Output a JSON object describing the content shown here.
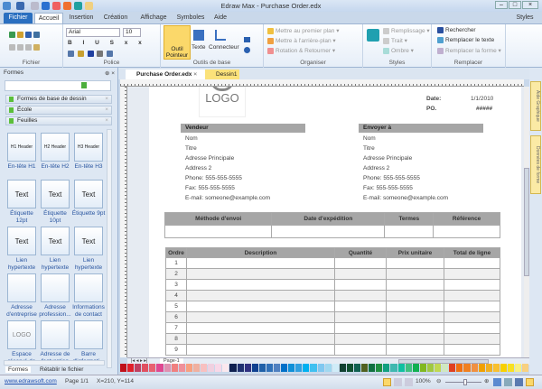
{
  "window": {
    "title": "Edraw Max - Purchase Order.edx",
    "styles_label": "Styles"
  },
  "tabs": [
    "Fichier",
    "Accueil",
    "Insertion",
    "Création",
    "Affichage",
    "Symboles",
    "Aide"
  ],
  "ribbon": {
    "groups": [
      "Fichier",
      "Police",
      "Outils de base",
      "Organiser",
      "Styles",
      "Remplacer"
    ],
    "font": "Arial",
    "font_size": "10",
    "outil_pointeur": "Outil Pointeur",
    "texte": "Texte",
    "connecteur": "Connecteur",
    "organiser": [
      "Mettre au premier plan",
      "Mettre à l'arrière-plan",
      "Rotation & Retourner"
    ],
    "styles": [
      "Remplissage",
      "Trait",
      "Ombre"
    ],
    "remplacer": [
      "Rechercher",
      "Remplacer le texte",
      "Remplacer la forme"
    ]
  },
  "left_panel": {
    "title": "Formes",
    "categories": [
      "Formes de base de dessin",
      "École",
      "Feuilles"
    ],
    "shapes": [
      {
        "label": "En-tête H1",
        "preview": "H1 Header"
      },
      {
        "label": "En-tête H2",
        "preview": "H2 Header"
      },
      {
        "label": "En-tête H3",
        "preview": "H3 Header"
      },
      {
        "label": "Étiquette 12pt",
        "preview": "Text"
      },
      {
        "label": "Étiquette 10pt",
        "preview": "Text"
      },
      {
        "label": "Étiquette 9pt",
        "preview": "Text"
      },
      {
        "label": "Lien hypertexte",
        "preview": "Text"
      },
      {
        "label": "Lien hypertexte",
        "preview": "Text"
      },
      {
        "label": "Lien hypertexte",
        "preview": "Text"
      },
      {
        "label": "Adresse d'entreprise",
        "preview": ""
      },
      {
        "label": "Adresse profession...",
        "preview": ""
      },
      {
        "label": "Informations de contact",
        "preview": ""
      },
      {
        "label": "Espace réservé de",
        "preview": "LOGO"
      },
      {
        "label": "Adresse de facturation",
        "preview": ""
      },
      {
        "label": "Barre d'informati...",
        "preview": ""
      }
    ],
    "bottom_tabs": [
      "Formes",
      "Rétablir le fichier"
    ]
  },
  "doc_tabs": [
    "Purchase Order.edx",
    "Dessin1"
  ],
  "right_tabs": [
    "Aide Graphique",
    "Données de forme"
  ],
  "document": {
    "logo": "LOGO",
    "date_label": "Date:",
    "date_value": "1/1/2010",
    "po_label": "PO.",
    "po_value": "#####",
    "vendor": {
      "header": "Vendeur",
      "lines": [
        "Nom",
        "Titre",
        "Adresse Principale",
        "Address 2",
        "Phone: 555-555-5555",
        "Fax: 555-555-5555",
        "E-mail: someone@example.com"
      ]
    },
    "ship_to": {
      "header": "Envoyer à",
      "lines": [
        "Nom",
        "Titre",
        "Adresse Principale",
        "Address 2",
        "Phone: 555-555-5555",
        "Fax: 555-555-5555",
        "E-mail: someone@example.com"
      ]
    },
    "shipping_headers": [
      "Méthode d'envoi",
      "Date d'expédition",
      "Termes",
      "Référence"
    ],
    "order_headers": [
      "Ordre",
      "Description",
      "Quantité",
      "Prix unitaire",
      "Total de ligne"
    ],
    "order_rows": [
      "1",
      "2",
      "3",
      "4",
      "5",
      "6",
      "7",
      "8",
      "9"
    ]
  },
  "page_tab": "Page-1",
  "palette": [
    "#c0101a",
    "#e0202a",
    "#c04060",
    "#e05060",
    "#e86070",
    "#e04890",
    "#e090b0",
    "#f08080",
    "#f0909a",
    "#f8a080",
    "#f0b0a0",
    "#f8c0c0",
    "#f0d0e0",
    "#f8d8e8",
    "#fbe8ee",
    "#102050",
    "#203070",
    "#303080",
    "#104090",
    "#2060a8",
    "#3070b8",
    "#5080c0",
    "#0070c8",
    "#1090d8",
    "#30a0e0",
    "#00b0f0",
    "#40c0f0",
    "#80c8f0",
    "#a0d8f0",
    "#d0ecf8",
    "#104030",
    "#105030",
    "#106050",
    "#506020",
    "#107040",
    "#209040",
    "#10a080",
    "#40b8b0",
    "#10c0a0",
    "#40c080",
    "#10b050",
    "#80b820",
    "#a0c840",
    "#c0d850",
    "#d0e8c0",
    "#e04020",
    "#f07010",
    "#f08020",
    "#f09040",
    "#f0a000",
    "#f0b020",
    "#f8c030",
    "#f8d000",
    "#f8e020",
    "#f8f080",
    "#f8d080"
  ],
  "status": {
    "link": "www.edrawsoft.com",
    "page": "Page 1/1",
    "coords": "X=210, Y=114",
    "zoom": "100%"
  }
}
